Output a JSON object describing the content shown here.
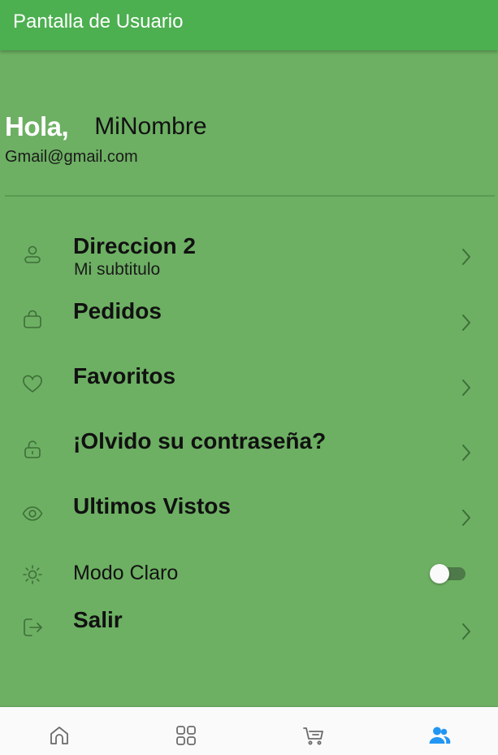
{
  "appbar": {
    "title": "Pantalla de Usuario"
  },
  "profile": {
    "greeting": "Hola,",
    "name": "MiNombre",
    "email": "Gmail@gmail.com"
  },
  "menu": {
    "address": {
      "title": "Direccion 2",
      "subtitle": "Mi subtitulo",
      "icon": "user-outline-icon"
    },
    "orders": {
      "title": "Pedidos",
      "icon": "shopping-bag-icon"
    },
    "favorites": {
      "title": "Favoritos",
      "icon": "heart-icon"
    },
    "password": {
      "title": "¡Olvido su contraseña?",
      "icon": "unlock-icon"
    },
    "recent": {
      "title": "Ultimos Vistos",
      "icon": "eye-icon"
    },
    "theme": {
      "label": "Modo Claro",
      "icon": "sun-icon",
      "enabled": false
    },
    "logout": {
      "title": "Salir",
      "icon": "logout-icon"
    }
  },
  "bottom_nav": {
    "items": [
      {
        "icon": "home-icon",
        "active": false
      },
      {
        "icon": "grid-icon",
        "active": false
      },
      {
        "icon": "cart-icon",
        "active": false
      },
      {
        "icon": "users-icon",
        "active": true
      }
    ]
  },
  "colors": {
    "appbar": "#4caf50",
    "background": "#6db063",
    "nav_active": "#2196f3",
    "nav_inactive": "#6b6b6b"
  }
}
